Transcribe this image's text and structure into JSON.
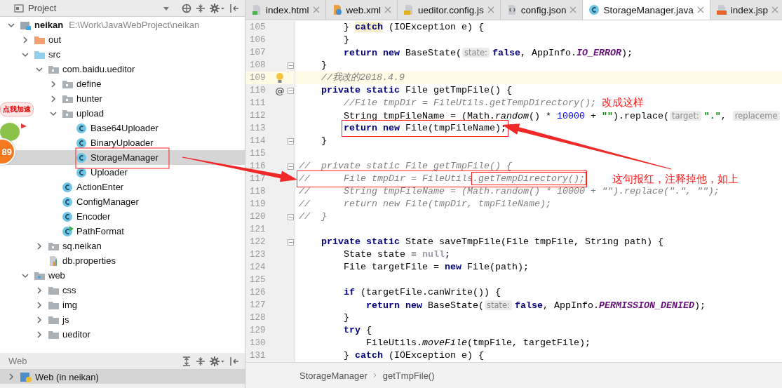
{
  "project_panel": {
    "title": "Project",
    "tree": [
      {
        "label": "neikan",
        "path": "E:\\Work\\JavaWebProject\\neikan",
        "kind": "module",
        "expanded": true,
        "selected": false,
        "children": [
          {
            "label": "out",
            "kind": "folder_out",
            "expanded": false,
            "selected": false
          },
          {
            "label": "src",
            "kind": "folder_src",
            "expanded": true,
            "selected": false,
            "children": [
              {
                "label": "com.baidu.ueditor",
                "kind": "package",
                "expanded": true,
                "selected": false,
                "children": [
                  {
                    "label": "define",
                    "kind": "package",
                    "expanded": false,
                    "selected": false
                  },
                  {
                    "label": "hunter",
                    "kind": "package",
                    "expanded": false,
                    "selected": false
                  },
                  {
                    "label": "upload",
                    "kind": "package",
                    "expanded": true,
                    "selected": false,
                    "children": [
                      {
                        "label": "Base64Uploader",
                        "kind": "class",
                        "selected": false
                      },
                      {
                        "label": "BinaryUploader",
                        "kind": "class",
                        "selected": false
                      },
                      {
                        "label": "StorageManager",
                        "kind": "class",
                        "selected": true
                      },
                      {
                        "label": "Uploader",
                        "kind": "class",
                        "selected": false
                      }
                    ]
                  },
                  {
                    "label": "ActionEnter",
                    "kind": "class",
                    "selected": false
                  },
                  {
                    "label": "ConfigManager",
                    "kind": "class",
                    "selected": false
                  },
                  {
                    "label": "Encoder",
                    "kind": "class",
                    "selected": false
                  },
                  {
                    "label": "PathFormat",
                    "kind": "class_run",
                    "selected": false
                  }
                ]
              },
              {
                "label": "sq.neikan",
                "kind": "package",
                "expanded": false,
                "selected": false
              },
              {
                "label": "db.properties",
                "kind": "properties",
                "selected": false
              }
            ]
          },
          {
            "label": "web",
            "kind": "folder_web",
            "expanded": true,
            "selected": false,
            "children": [
              {
                "label": "css",
                "kind": "folder",
                "expanded": false,
                "selected": false
              },
              {
                "label": "img",
                "kind": "folder",
                "expanded": false,
                "selected": false
              },
              {
                "label": "js",
                "kind": "folder",
                "expanded": false,
                "selected": false
              },
              {
                "label": "ueditor",
                "kind": "folder",
                "expanded": false,
                "selected": false
              }
            ]
          }
        ]
      }
    ]
  },
  "web_panel": {
    "title": "Web",
    "items": [
      {
        "label": "Web (in neikan)",
        "expanded": false,
        "selected": true
      }
    ]
  },
  "tabs": [
    {
      "label": "index.html",
      "kind": "html",
      "selected": false
    },
    {
      "label": "web.xml",
      "kind": "xml",
      "selected": false
    },
    {
      "label": "ueditor.config.js",
      "kind": "js",
      "selected": false
    },
    {
      "label": "config.json",
      "kind": "json",
      "selected": false
    },
    {
      "label": "StorageManager.java",
      "kind": "java",
      "selected": true
    },
    {
      "label": "index.jsp",
      "kind": "jsp",
      "selected": false
    }
  ],
  "code_lines": [
    {
      "number": "105",
      "fold": false,
      "current": false,
      "kind": "double",
      "tokens": [
        {
          "kind": "plain",
          "text": "} "
        },
        {
          "kind": "keyword_match",
          "text": "catch"
        },
        {
          "kind": "plain",
          "text": " (IOException e) {"
        }
      ]
    },
    {
      "number": "106",
      "fold": false,
      "current": false,
      "kind": "double",
      "tokens": [
        {
          "kind": "plain",
          "text": "}"
        }
      ]
    },
    {
      "number": "107",
      "fold": false,
      "current": false,
      "kind": "double",
      "tokens": [
        {
          "kind": "keyword",
          "text": "return new"
        },
        {
          "kind": "plain",
          "text": " BaseState("
        },
        {
          "kind": "hint",
          "text": "state:"
        },
        {
          "kind": "keyword",
          "text": "false"
        },
        {
          "kind": "plain",
          "text": ", AppInfo."
        },
        {
          "kind": "constant",
          "text": "IO_ERROR"
        },
        {
          "kind": "plain",
          "text": ");"
        }
      ]
    },
    {
      "number": "108",
      "fold": true,
      "current": false,
      "kind": "single",
      "tokens": [
        {
          "kind": "plain",
          "text": "}"
        }
      ]
    },
    {
      "number": "109",
      "fold": false,
      "current": true,
      "kind": "single",
      "marker": {
        "kind": "bulb"
      },
      "tokens": [
        {
          "kind": "comment",
          "text": "//我改的2018.4.9"
        }
      ]
    },
    {
      "number": "110",
      "fold": true,
      "current": false,
      "kind": "single",
      "marker": {
        "kind": "text",
        "text": "@"
      },
      "tokens": [
        {
          "kind": "keyword",
          "text": "private static"
        },
        {
          "kind": "plain",
          "text": " File getTmpFile() {"
        }
      ]
    },
    {
      "number": "111",
      "fold": false,
      "current": false,
      "kind": "double",
      "tokens": [
        {
          "kind": "comment",
          "text": "//File tmpDir = FileUtils.getTempDirectory();"
        }
      ]
    },
    {
      "number": "112",
      "fold": false,
      "current": false,
      "kind": "double",
      "tokens": [
        {
          "kind": "plain",
          "text": "String tmpFileName = (Math."
        },
        {
          "kind": "static_call",
          "text": "random"
        },
        {
          "kind": "plain",
          "text": "() * "
        },
        {
          "kind": "number",
          "text": "10000"
        },
        {
          "kind": "plain",
          "text": " + "
        },
        {
          "kind": "string",
          "text": "\"\""
        },
        {
          "kind": "plain",
          "text": ").replace("
        },
        {
          "kind": "hint",
          "text": "target:"
        },
        {
          "kind": "string",
          "text": "\".\""
        },
        {
          "kind": "plain",
          "text": ", "
        },
        {
          "kind": "hint",
          "text": "replaceme"
        }
      ]
    },
    {
      "number": "113",
      "fold": false,
      "current": false,
      "kind": "double",
      "tokens": [
        {
          "kind": "keyword",
          "text": "return new"
        },
        {
          "kind": "plain",
          "text": " File(tmpFileName);"
        }
      ]
    },
    {
      "number": "114",
      "fold": true,
      "current": false,
      "kind": "single",
      "tokens": [
        {
          "kind": "plain",
          "text": "}"
        }
      ]
    },
    {
      "number": "115",
      "fold": false,
      "current": false
    },
    {
      "number": "116",
      "fold": true,
      "current": false,
      "kind": "flush",
      "tokens": [
        {
          "kind": "comment",
          "text": "//  private static File getTmpFile() {"
        }
      ]
    },
    {
      "number": "117",
      "fold": false,
      "current": false,
      "kind": "flush",
      "tokens": [
        {
          "kind": "comment",
          "text": "//      File tmpDir = FileUtils"
        },
        {
          "kind": "comment",
          "text": ".getTempDirectory();"
        }
      ]
    },
    {
      "number": "118",
      "fold": false,
      "current": false,
      "kind": "flush",
      "tokens": [
        {
          "kind": "comment",
          "text": "//      String tmpFileName = (Math.random() * 10000 + \"\").replace(\".\", \"\");"
        }
      ]
    },
    {
      "number": "119",
      "fold": false,
      "current": false,
      "kind": "flush",
      "tokens": [
        {
          "kind": "comment",
          "text": "//      return new File(tmpDir, tmpFileName);"
        }
      ]
    },
    {
      "number": "120",
      "fold": true,
      "current": false,
      "kind": "flush",
      "tokens": [
        {
          "kind": "comment",
          "text": "//  }"
        }
      ]
    },
    {
      "number": "121",
      "fold": false,
      "current": false
    },
    {
      "number": "122",
      "fold": true,
      "current": false,
      "kind": "single",
      "tokens": [
        {
          "kind": "keyword",
          "text": "private static"
        },
        {
          "kind": "plain",
          "text": " State saveTmpFile(File tmpFile, String path) {"
        }
      ]
    },
    {
      "number": "123",
      "fold": false,
      "current": false,
      "kind": "double",
      "tokens": [
        {
          "kind": "plain",
          "text": "State state = "
        },
        {
          "kind": "null",
          "text": "null"
        },
        {
          "kind": "plain",
          "text": ";"
        }
      ]
    },
    {
      "number": "124",
      "fold": false,
      "current": false,
      "kind": "double",
      "tokens": [
        {
          "kind": "plain",
          "text": "File targetFile = "
        },
        {
          "kind": "keyword",
          "text": "new"
        },
        {
          "kind": "plain",
          "text": " File(path);"
        }
      ]
    },
    {
      "number": "125",
      "fold": false,
      "current": false
    },
    {
      "number": "126",
      "fold": false,
      "current": false,
      "kind": "double",
      "tokens": [
        {
          "kind": "keyword",
          "text": "if"
        },
        {
          "kind": "plain",
          "text": " (targetFile.canWrite()) {"
        }
      ]
    },
    {
      "number": "127",
      "fold": false,
      "current": false,
      "kind": "triple",
      "tokens": [
        {
          "kind": "keyword",
          "text": "return new"
        },
        {
          "kind": "plain",
          "text": " BaseState("
        },
        {
          "kind": "hint",
          "text": "state:"
        },
        {
          "kind": "keyword",
          "text": "false"
        },
        {
          "kind": "plain",
          "text": ", AppInfo."
        },
        {
          "kind": "constant",
          "text": "PERMISSION_DENIED"
        },
        {
          "kind": "plain",
          "text": ");"
        }
      ]
    },
    {
      "number": "128",
      "fold": false,
      "current": false,
      "kind": "double",
      "tokens": [
        {
          "kind": "plain",
          "text": "}"
        }
      ]
    },
    {
      "number": "129",
      "fold": false,
      "current": false,
      "kind": "double",
      "tokens": [
        {
          "kind": "keyword",
          "text": "try"
        },
        {
          "kind": "plain",
          "text": " {"
        }
      ]
    },
    {
      "number": "130",
      "fold": false,
      "current": false,
      "kind": "triple",
      "tokens": [
        {
          "kind": "plain",
          "text": "FileUtils."
        },
        {
          "kind": "static_call",
          "text": "moveFile"
        },
        {
          "kind": "plain",
          "text": "(tmpFile, targetFile);"
        }
      ]
    },
    {
      "number": "131",
      "fold": false,
      "current": false,
      "kind": "double",
      "tokens": [
        {
          "kind": "plain",
          "text": "} "
        },
        {
          "kind": "keyword",
          "text": "catch"
        },
        {
          "kind": "plain",
          "text": " (IOException e) {"
        }
      ]
    }
  ],
  "breadcrumbs": [
    "StorageManager",
    "getTmpFile()"
  ],
  "annotations": [
    {
      "text": "改成这样"
    },
    {
      "text": "这句报红，注释掉他，如上"
    }
  ],
  "floating_widget": {
    "bubble": "点我加速",
    "count": "89"
  }
}
